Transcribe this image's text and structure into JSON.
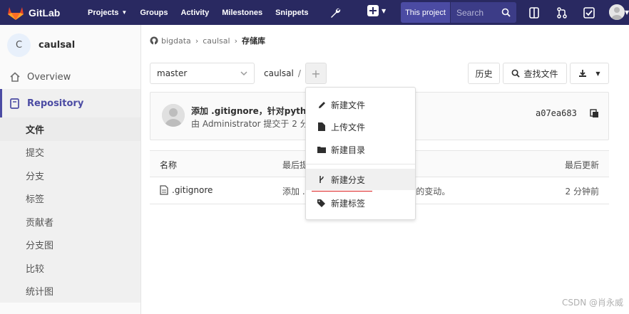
{
  "nav": {
    "brand": "GitLab",
    "links": [
      {
        "label": "Projects",
        "has_caret": true
      },
      {
        "label": "Groups",
        "has_caret": false
      },
      {
        "label": "Activity",
        "has_caret": false
      },
      {
        "label": "Milestones",
        "has_caret": false
      },
      {
        "label": "Snippets",
        "has_caret": false
      }
    ],
    "scope_label": "This project",
    "search_placeholder": "Search",
    "colors": {
      "bg": "#292961",
      "accent": "#4b4ba3"
    }
  },
  "sidebar": {
    "project_initial": "C",
    "project_name": "caulsal",
    "overview_label": "Overview",
    "repository_label": "Repository",
    "sub_items": [
      "文件",
      "提交",
      "分支",
      "标签",
      "贡献者",
      "分支图",
      "比较",
      "统计图"
    ]
  },
  "breadcrumb": {
    "items": [
      "bigdata",
      "caulsal",
      "存储库"
    ]
  },
  "toolbar": {
    "branch": "master",
    "path": "caulsal",
    "path_sep": "/",
    "add_label": "+",
    "history_label": "历史",
    "find_file_label": "查找文件"
  },
  "commit": {
    "title": "添加 .gitignore，针对python",
    "meta": "由 Administrator 提交于 2 分钟前",
    "sha": "a07ea683"
  },
  "table": {
    "headers": {
      "name": "名称",
      "last_commit": "最后提交",
      "last_update": "最后更新"
    },
    "rows": [
      {
        "name": ".gitignore",
        "commit": "添加 .gitignore，针对python文件的变动。",
        "updated": "2 分钟前"
      }
    ]
  },
  "dropdown": {
    "items": [
      {
        "label": "新建文件",
        "icon": "pencil-icon"
      },
      {
        "label": "上传文件",
        "icon": "file-icon"
      },
      {
        "label": "新建目录",
        "icon": "folder-icon"
      },
      {
        "label": "新建分支",
        "icon": "branch-icon"
      },
      {
        "label": "新建标签",
        "icon": "tag-icon"
      }
    ]
  },
  "watermark": "CSDN @肖永威"
}
